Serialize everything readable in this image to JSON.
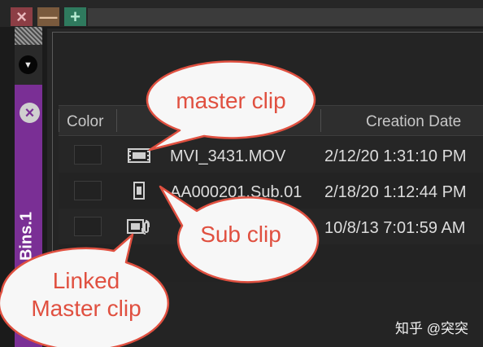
{
  "window_controls": {
    "close_glyph": "×",
    "minimize_glyph": "—",
    "maximize_glyph": "+"
  },
  "bin_tab": {
    "label": "Bins.1",
    "dropdown_glyph": "▼",
    "close_glyph": "×"
  },
  "table": {
    "columns": [
      "Color",
      "",
      "Creation Date"
    ],
    "rows": [
      {
        "icon": "film-clip-icon",
        "name": "MVI_3431.MOV",
        "creation_date": "2/12/20 1:31:10 PM"
      },
      {
        "icon": "sub-clip-icon",
        "name": "AA000201.Sub.01",
        "creation_date": "2/18/20 1:12:44 PM"
      },
      {
        "icon": "linked-clip-icon",
        "name": "",
        "creation_date": "10/8/13 7:01:59 AM"
      }
    ]
  },
  "callouts": {
    "master_clip": "master clip",
    "sub_clip": "Sub clip",
    "linked_master_line1": "Linked",
    "linked_master_line2": "Master clip"
  },
  "watermark": "知乎 @突突",
  "colors": {
    "bin_tab": "#7a2f95",
    "callout_fill": "#f7f7f7",
    "callout_stroke": "#e05040",
    "callout_text": "#e05040"
  }
}
